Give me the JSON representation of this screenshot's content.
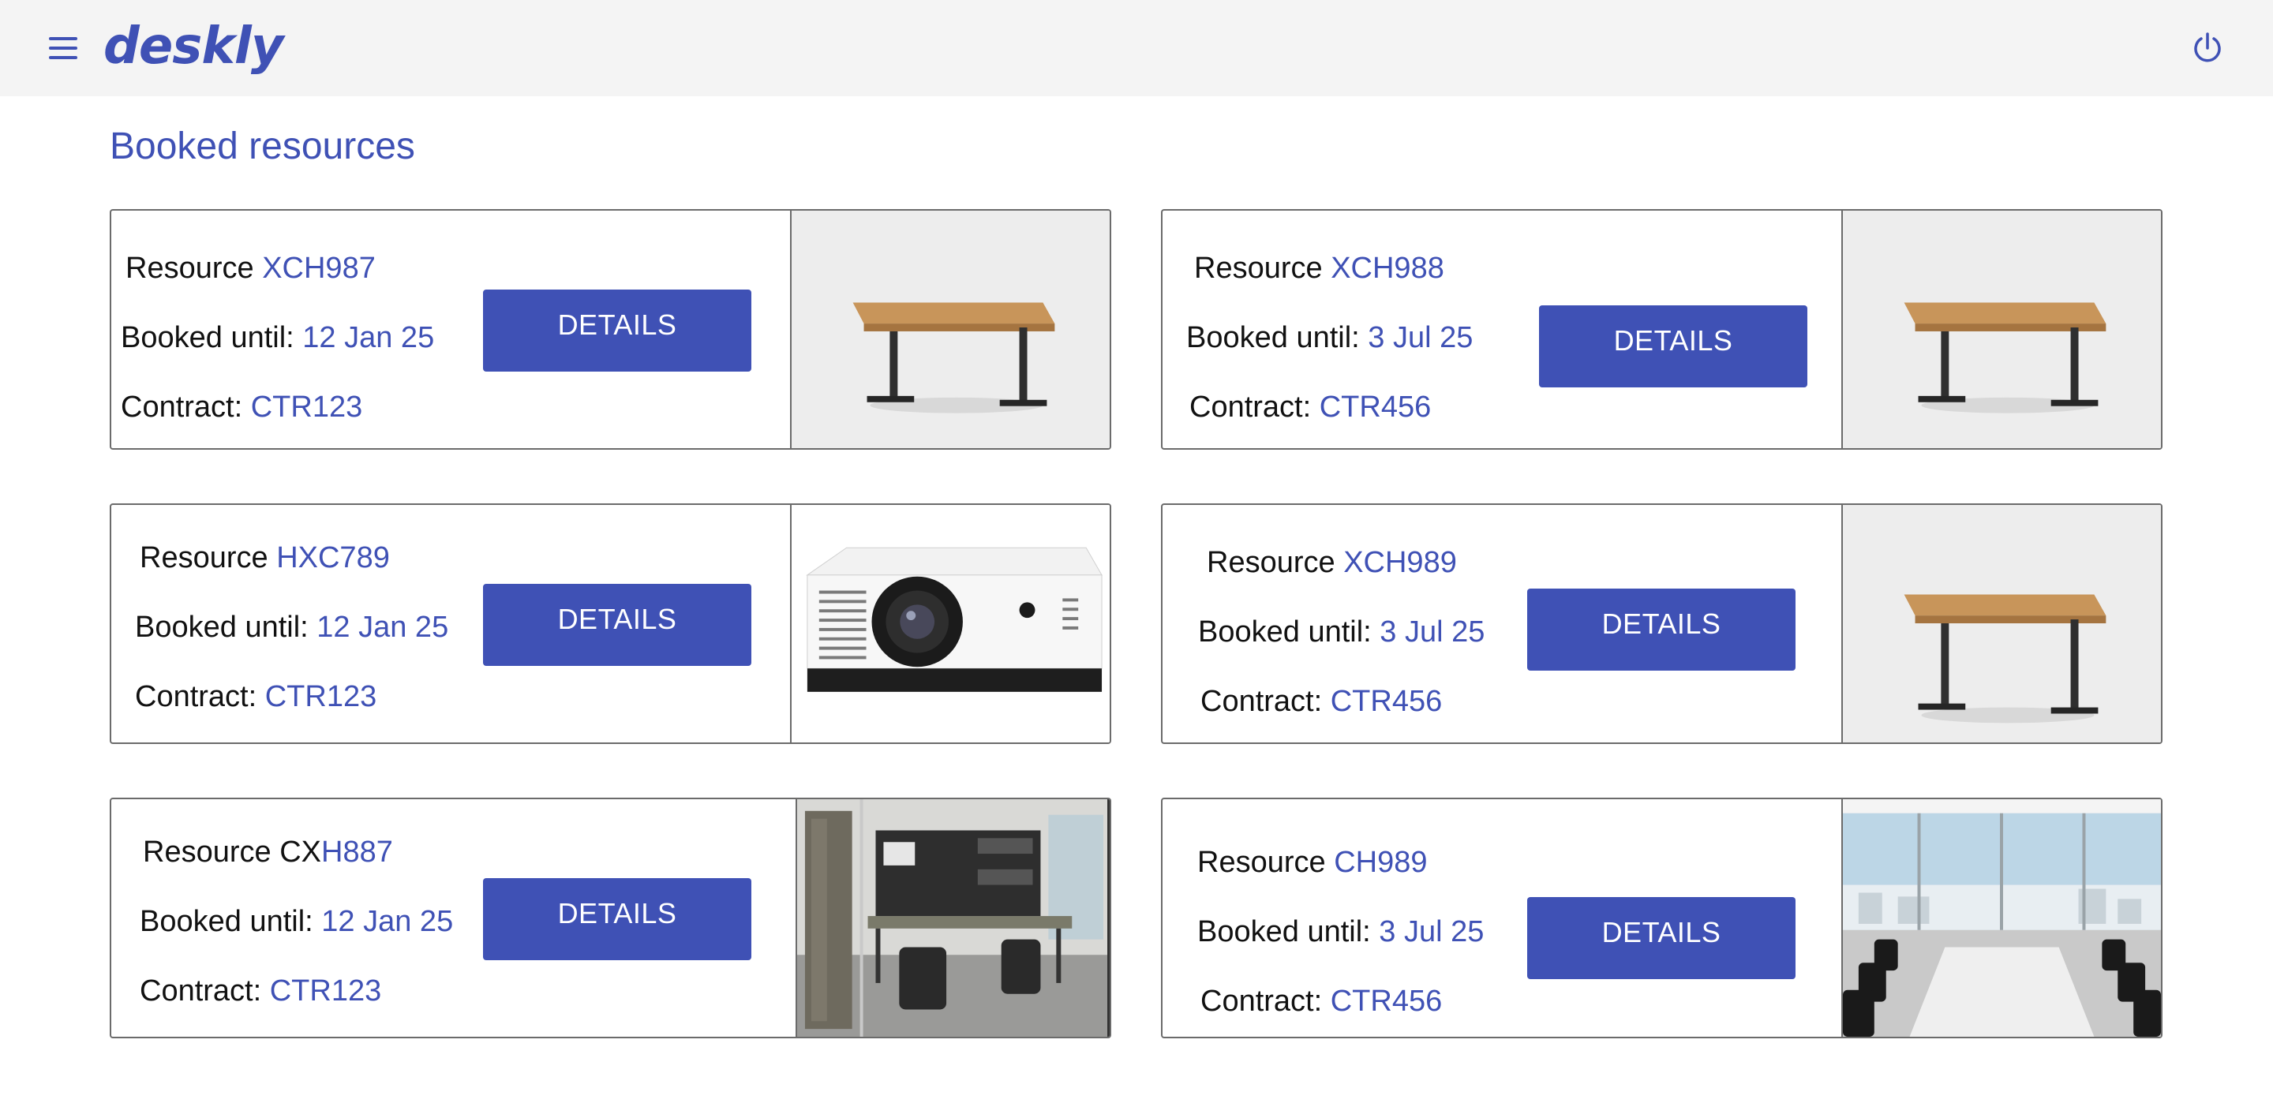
{
  "app": {
    "name": "deskly"
  },
  "header": {
    "menu_icon": "menu-icon",
    "power_icon": "power-icon"
  },
  "page": {
    "title": "Booked resources"
  },
  "labels": {
    "resource": "Resource",
    "booked_until": "Booked until:",
    "contract": "Contract:",
    "details": "DETAILS"
  },
  "cards": [
    {
      "resource_prefix": "",
      "resource_id": "XCH987",
      "booked_until": "12 Jan 25",
      "contract": "CTR123",
      "image": "standing-desk"
    },
    {
      "resource_prefix": "",
      "resource_id": "XCH988",
      "booked_until": "3 Jul 25",
      "contract": "CTR456",
      "image": "standing-desk"
    },
    {
      "resource_prefix": "",
      "resource_id": "HXC789",
      "booked_until": "12 Jan 25",
      "contract": "CTR123",
      "image": "projector"
    },
    {
      "resource_prefix": "",
      "resource_id": "XCH989",
      "booked_until": "3 Jul 25",
      "contract": "CTR456",
      "image": "standing-desk"
    },
    {
      "resource_prefix": "CX",
      "resource_id": "H887",
      "booked_until": "12 Jan 25",
      "contract": "CTR123",
      "image": "office-room"
    },
    {
      "resource_prefix": "",
      "resource_id": "CH989",
      "booked_until": "3 Jul 25",
      "contract": "CTR456",
      "image": "meeting-room"
    }
  ],
  "colors": {
    "accent": "#3f51b5",
    "header_bg": "#f4f4f4",
    "text": "#111111"
  }
}
